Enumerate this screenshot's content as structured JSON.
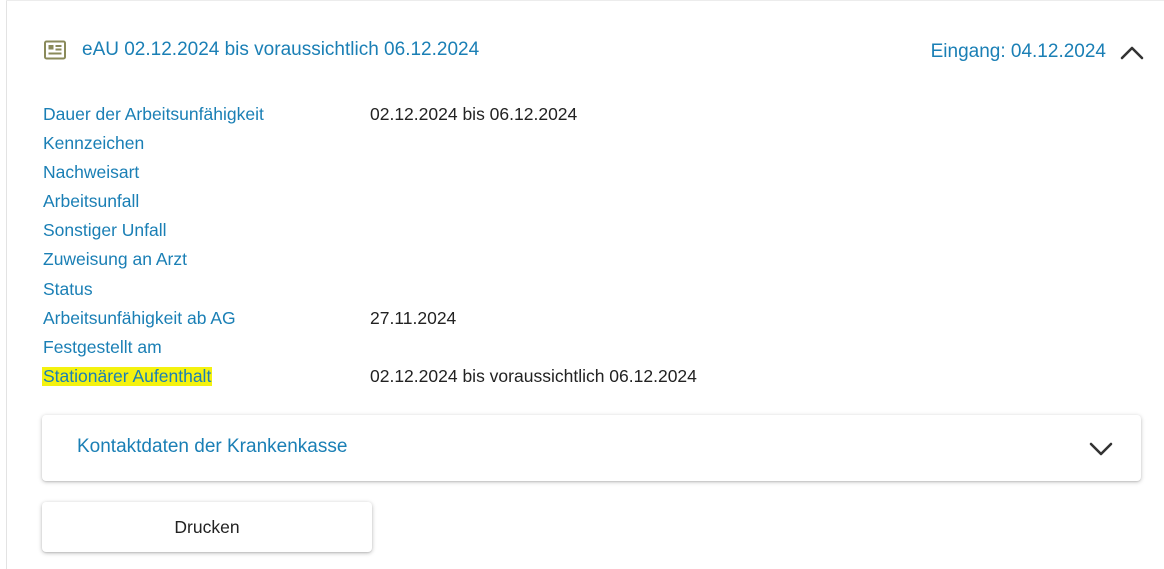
{
  "panel": {
    "title": "eAU 02.12.2024 bis voraussichtlich 06.12.2024",
    "eingang": "Eingang: 04.12.2024",
    "icon": "id-card-icon",
    "toggle_icon": "chevron-up-icon",
    "expanded": true
  },
  "details": [
    {
      "label": "Dauer der Arbeitsunfähigkeit",
      "value": "02.12.2024 bis 06.12.2024"
    },
    {
      "label": "Kennzeichen",
      "value": ""
    },
    {
      "label": "Nachweisart",
      "value": ""
    },
    {
      "label": "Arbeitsunfall",
      "value": ""
    },
    {
      "label": "Sonstiger Unfall",
      "value": ""
    },
    {
      "label": "Zuweisung an Arzt",
      "value": ""
    },
    {
      "label": "Status",
      "value": ""
    },
    {
      "label": "Arbeitsunfähigkeit ab AG",
      "value": "27.11.2024"
    },
    {
      "label": "Festgestellt am",
      "value": ""
    },
    {
      "label": "Stationärer Aufenthalt",
      "value": "02.12.2024 bis voraussichtlich 06.12.2024",
      "highlighted": true
    }
  ],
  "contact_panel": {
    "title": "Kontaktdaten der Krankenkasse",
    "toggle_icon": "chevron-down-icon",
    "expanded": false
  },
  "print_button": {
    "label": "Drucken"
  },
  "colors": {
    "accent": "#1a7fb5",
    "highlight": "#f4f20f",
    "icon": "#8a8a5a",
    "text": "#222222"
  }
}
